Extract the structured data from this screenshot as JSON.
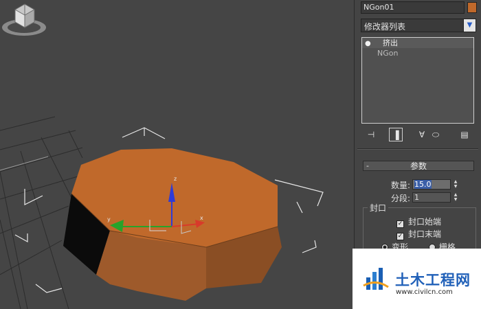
{
  "command_panel": {
    "object_name": "NGon01",
    "object_color": "#c0692b",
    "modifier_list_label": "修改器列表",
    "stack": [
      {
        "label": "挤出",
        "selected": true,
        "icon": "lightbulb-icon"
      },
      {
        "label": "NGon",
        "selected": false
      }
    ],
    "stack_tools": [
      "pin-stack-icon",
      "show-end-result-icon",
      "make-unique-icon",
      "remove-modifier-icon",
      "configure-modifier-sets-icon"
    ],
    "rollout": {
      "title": "参数",
      "collapse_symbol": "-",
      "amount_label": "数量:",
      "amount_value": "15.0",
      "segments_label": "分段:",
      "segments_value": "1",
      "capping_group": "封口",
      "cap_start_label": "封口始端",
      "cap_end_label": "封口末端",
      "morph_label": "变形",
      "grid_label": "栅格"
    }
  },
  "viewport": {
    "object_color": "#c0692b",
    "gizmo_axes": [
      "z",
      "y",
      "x"
    ]
  },
  "watermark": {
    "cn_text": "土木工程网",
    "url": "www.civilcn.com"
  }
}
